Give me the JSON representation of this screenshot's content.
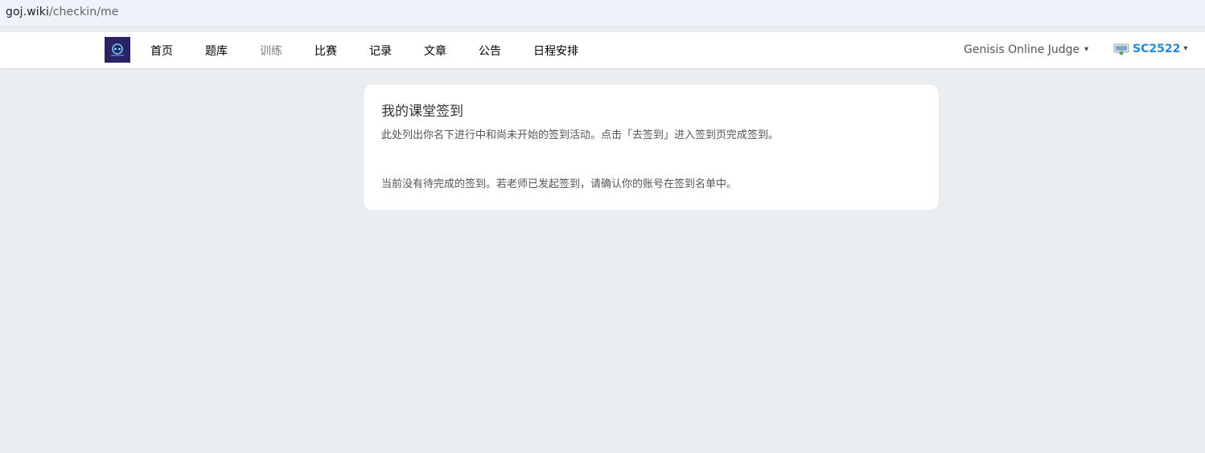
{
  "browser": {
    "url_host": "goj.wiki",
    "url_path": "/checkin/me"
  },
  "navbar": {
    "items": [
      {
        "label": "首页"
      },
      {
        "label": "题库"
      },
      {
        "label": "训练"
      },
      {
        "label": "比赛"
      },
      {
        "label": "记录"
      },
      {
        "label": "文章"
      },
      {
        "label": "公告"
      },
      {
        "label": "日程安排"
      }
    ],
    "site_menu": "Genisis Online Judge",
    "user": "SC2522"
  },
  "card": {
    "title": "我的课堂签到",
    "description": "此处列出你名下进行中和尚未开始的签到活动。点击「去签到」进入签到页完成签到。",
    "empty_message": "当前没有待完成的签到。若老师已发起签到，请确认你的账号在签到名单中。"
  },
  "colors": {
    "page_bg": "#ebeef1",
    "logo_bg": "#2a2466",
    "user_accent": "#1e88e5"
  }
}
